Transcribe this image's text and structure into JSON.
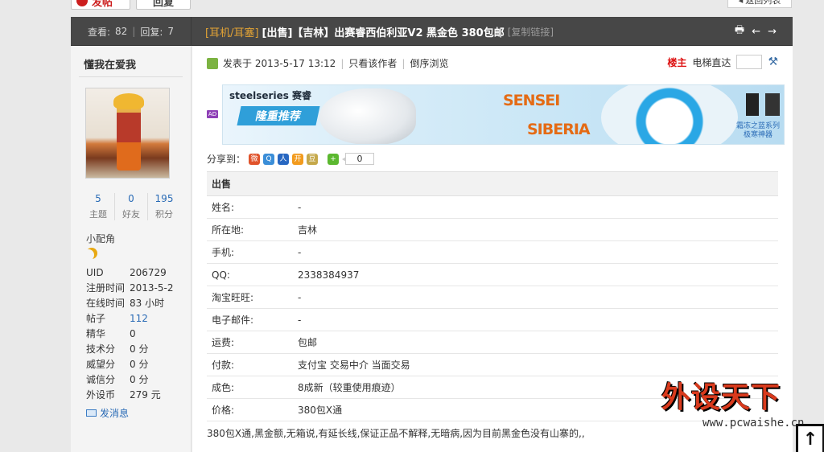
{
  "topbar": {
    "post_label": "发帖",
    "reply_label": "回复",
    "back_label": "返回列表"
  },
  "thread": {
    "views_label": "查看:",
    "views": "82",
    "replies_label": "回复:",
    "replies": "7",
    "category": "[耳机/耳塞]",
    "title": "[出售]【吉林】出赛睿西伯利亚V2 黑金色 380包邮",
    "copy_link": "[复制链接]"
  },
  "user": {
    "name": "懂我在爱我",
    "stats": [
      {
        "num": "5",
        "label": "主题"
      },
      {
        "num": "0",
        "label": "好友"
      },
      {
        "num": "195",
        "label": "积分"
      }
    ],
    "rank": "小配角",
    "info": [
      {
        "k": "UID",
        "v": "206729"
      },
      {
        "k": "注册时间",
        "v": "2013-5-2"
      },
      {
        "k": "在线时间",
        "v": "83 小时"
      },
      {
        "k": "帖子",
        "v": "112"
      },
      {
        "k": "精华",
        "v": "0"
      },
      {
        "k": "技术分",
        "v": "0 分"
      },
      {
        "k": "威望分",
        "v": "0 分"
      },
      {
        "k": "诚信分",
        "v": "0 分"
      },
      {
        "k": "外设币",
        "v": "279 元"
      }
    ],
    "send_msg": "发消息"
  },
  "post": {
    "posted_at": "发表于 2013-5-17 13:12",
    "only_author": "只看该作者",
    "reverse": "倒序浏览",
    "floor": "楼主",
    "jump": "电梯直达",
    "share_label": "分享到：",
    "share_count": "0"
  },
  "ad": {
    "badge": "AD",
    "brand": "steelseries 赛睿",
    "promo": "隆重推荐",
    "sensei": "SENSEI",
    "siberia": "SIBERIA",
    "caption1": "霜冻之蓝系列",
    "caption2": "极寒神器"
  },
  "trade": {
    "header": "出售",
    "rows": [
      {
        "k": "姓名:",
        "v": "-"
      },
      {
        "k": "所在地:",
        "v": "吉林"
      },
      {
        "k": "手机:",
        "v": "-"
      },
      {
        "k": "QQ:",
        "v": "2338384937"
      },
      {
        "k": "淘宝旺旺:",
        "v": "-"
      },
      {
        "k": "电子邮件:",
        "v": "-"
      },
      {
        "k": "运费:",
        "v": "包邮"
      },
      {
        "k": "付款:",
        "v": "支付宝 交易中介 当面交易"
      },
      {
        "k": "成色:",
        "v": "8成新（较重使用痕迹）"
      },
      {
        "k": "价格:",
        "v": "380包X通"
      }
    ],
    "description": "380包X通,黑金额,无箱说,有延长线,保证正品不解释,无暗病,因为目前黑金色没有山寨的,,"
  },
  "watermark": {
    "text": "外设天下",
    "url": "www.pcwaishe.cn"
  }
}
